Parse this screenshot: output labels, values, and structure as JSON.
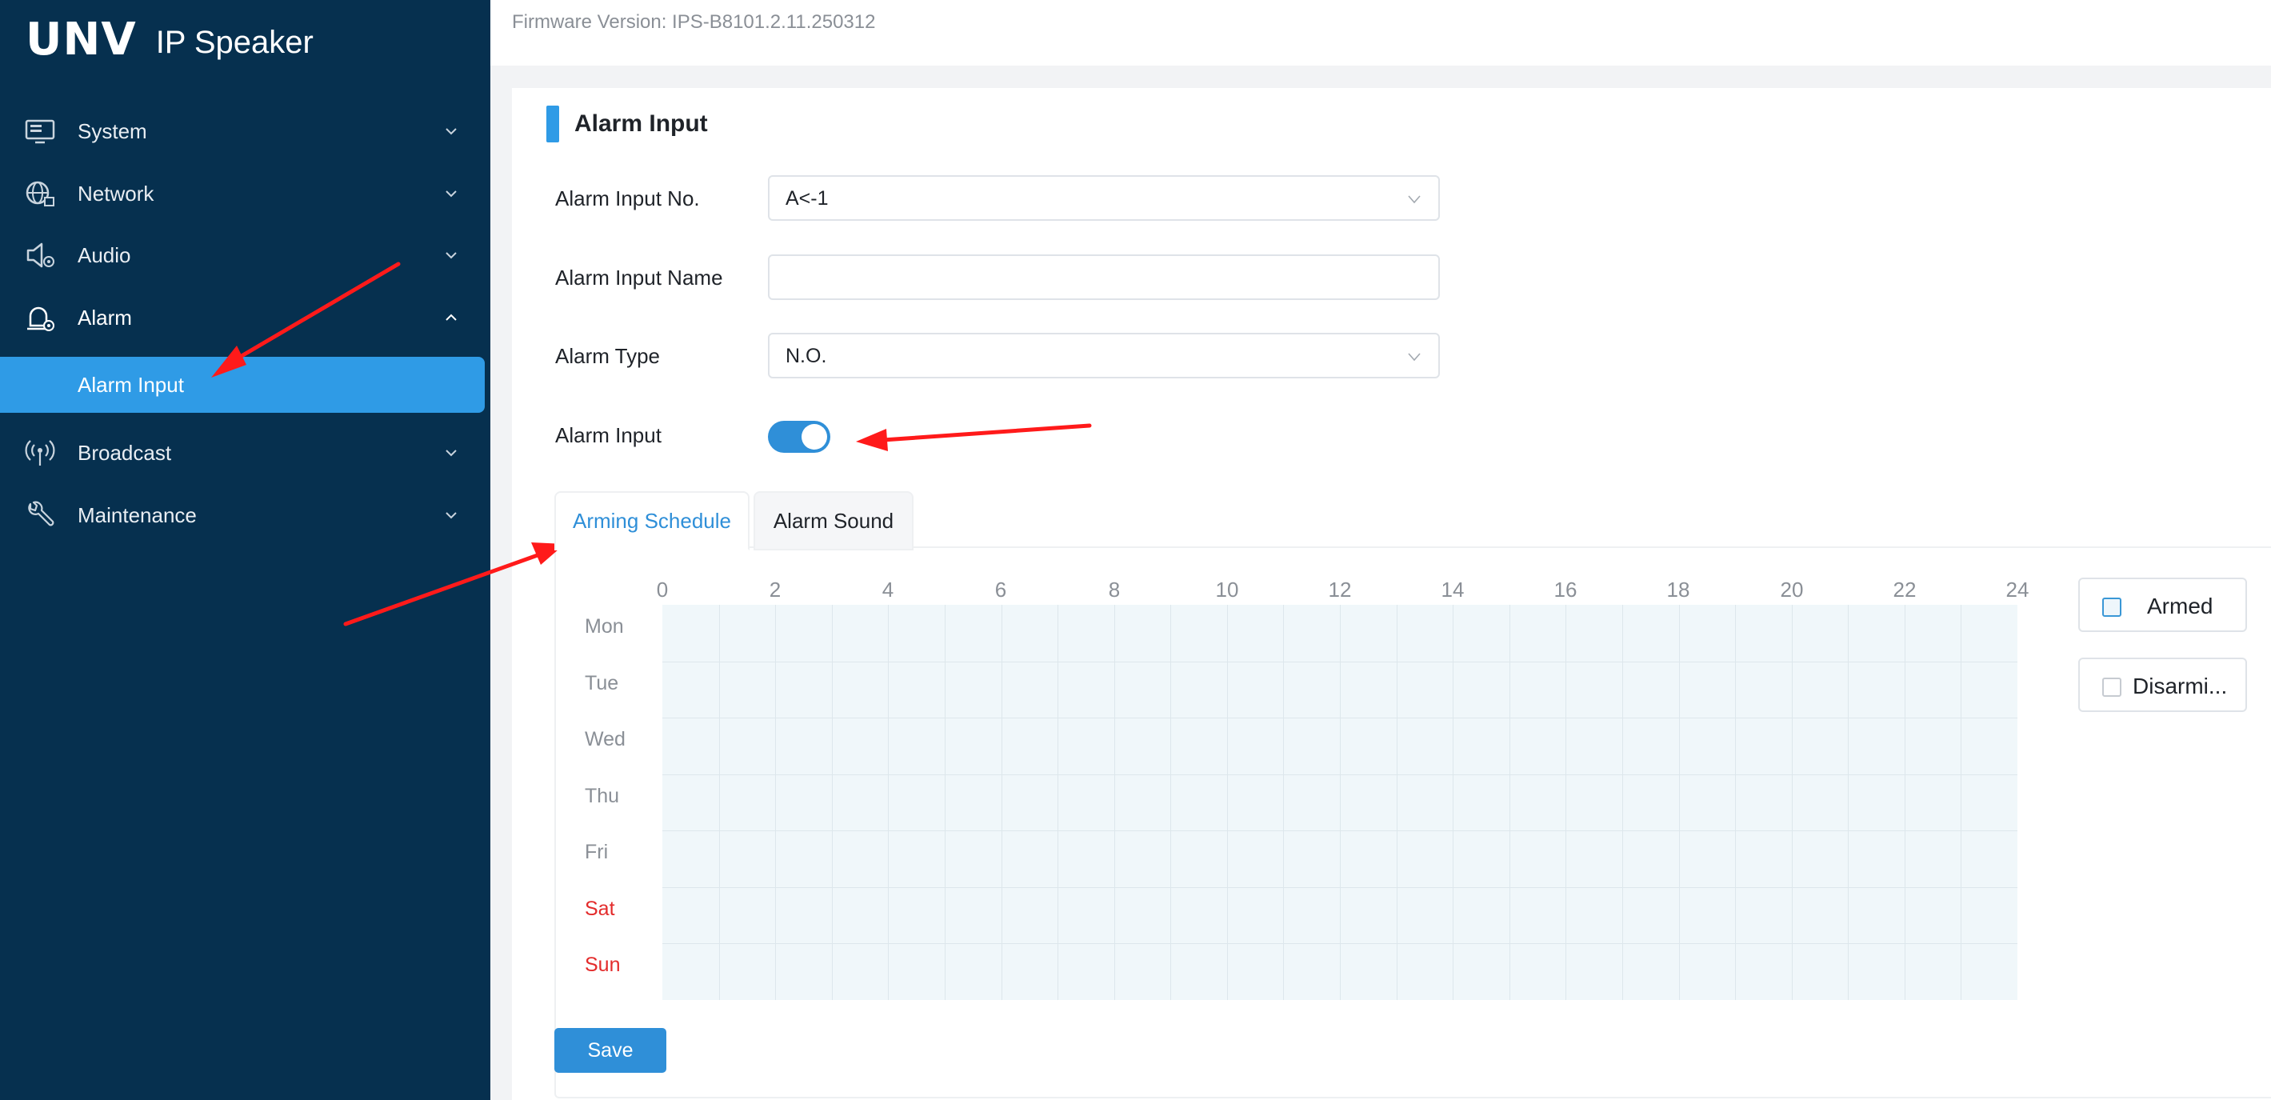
{
  "brand": {
    "logo": "UNV",
    "title": "IP Speaker"
  },
  "sidebar": {
    "items": [
      {
        "label": "System",
        "icon": "monitor-icon",
        "expanded": false
      },
      {
        "label": "Network",
        "icon": "globe-icon",
        "expanded": false
      },
      {
        "label": "Audio",
        "icon": "speaker-icon",
        "expanded": false
      },
      {
        "label": "Alarm",
        "icon": "alarm-icon",
        "expanded": true,
        "children": [
          {
            "label": "Alarm Input",
            "active": true
          }
        ]
      },
      {
        "label": "Broadcast",
        "icon": "broadcast-icon",
        "expanded": false
      },
      {
        "label": "Maintenance",
        "icon": "wrench-icon",
        "expanded": false
      }
    ]
  },
  "header": {
    "firmware": "Firmware Version: IPS-B8101.2.11.250312"
  },
  "section": {
    "title": "Alarm Input"
  },
  "form": {
    "alarm_input_no": {
      "label": "Alarm Input No.",
      "value": "A<-1"
    },
    "alarm_input_name": {
      "label": "Alarm Input Name",
      "value": ""
    },
    "alarm_type": {
      "label": "Alarm Type",
      "value": "N.O."
    },
    "alarm_input": {
      "label": "Alarm Input",
      "enabled": true
    }
  },
  "tabs": [
    {
      "label": "Arming Schedule",
      "active": true
    },
    {
      "label": "Alarm Sound",
      "active": false
    }
  ],
  "schedule": {
    "hours": [
      "0",
      "2",
      "4",
      "6",
      "8",
      "10",
      "12",
      "14",
      "16",
      "18",
      "20",
      "22",
      "24"
    ],
    "days": [
      "Mon",
      "Tue",
      "Wed",
      "Thu",
      "Fri",
      "Sat",
      "Sun"
    ],
    "weekend_days": [
      "Sat",
      "Sun"
    ],
    "armed_label": "Armed",
    "disarmed_label": "Disarmi..."
  },
  "actions": {
    "save_label": "Save"
  },
  "colors": {
    "sidebar_bg": "#06304f",
    "accent": "#2f9be6",
    "weekend": "#e32b2b",
    "grid_bg": "#f0f7fa",
    "annotation_arrow": "#ff1a1a"
  }
}
